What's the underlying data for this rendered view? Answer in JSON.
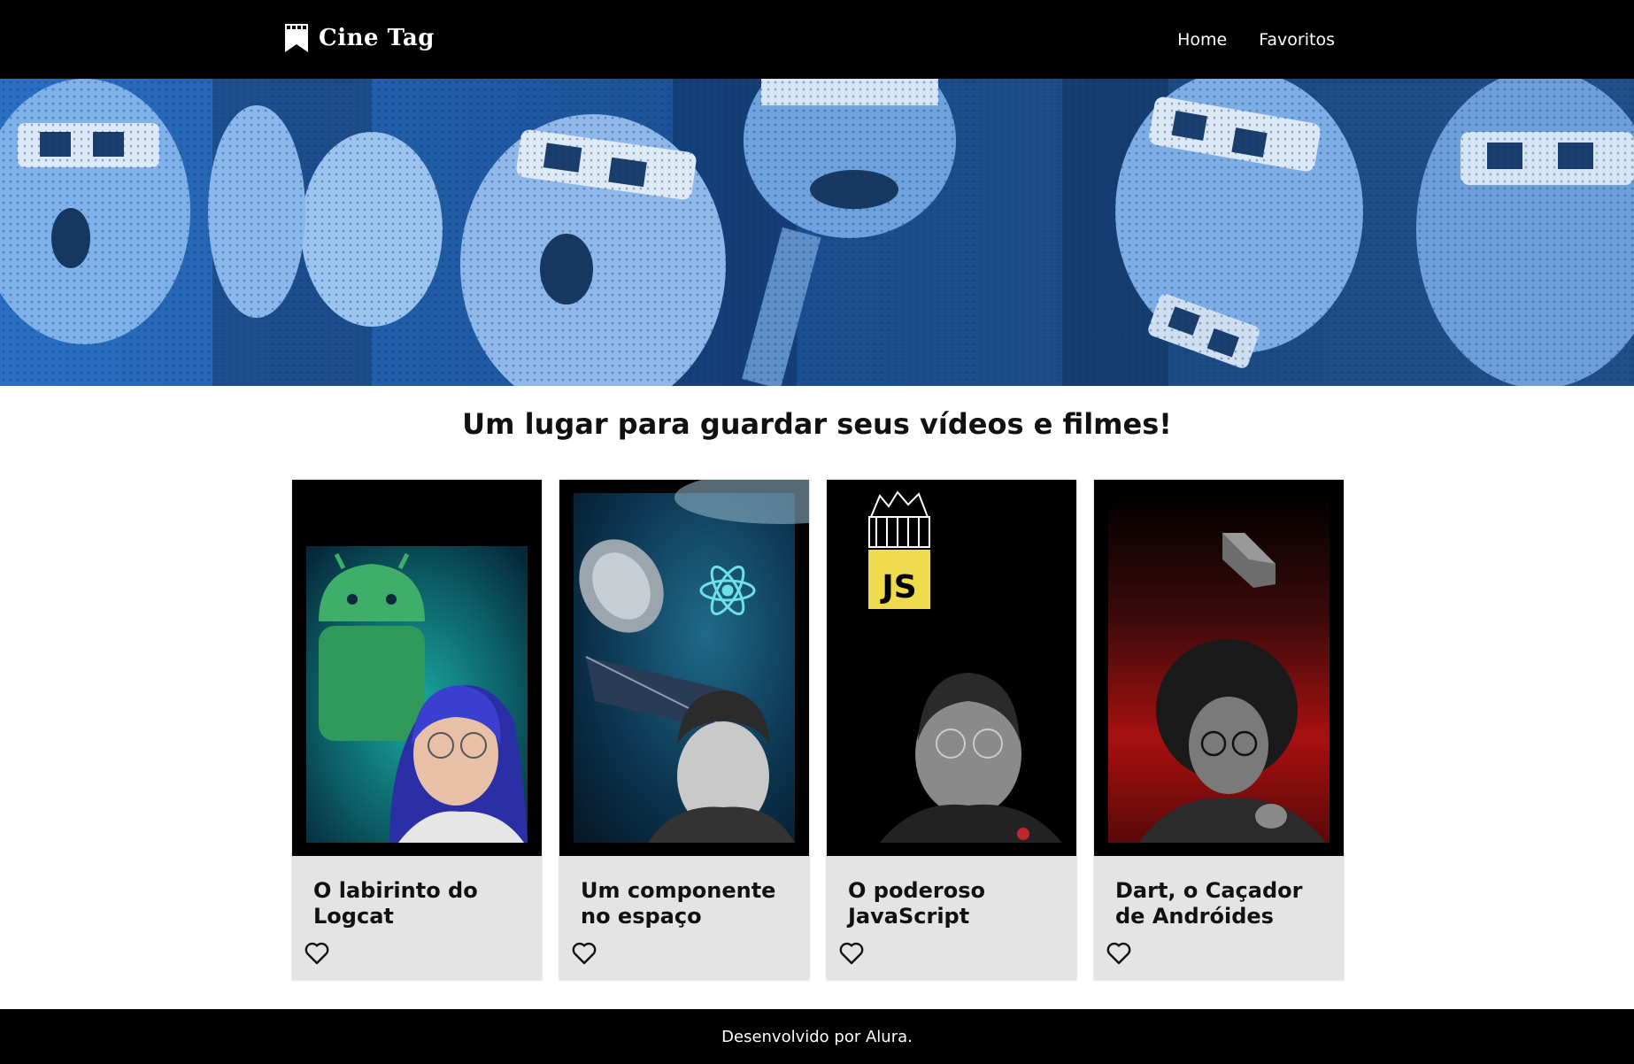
{
  "header": {
    "brand": "Cine Tag",
    "nav": [
      {
        "label": "Home"
      },
      {
        "label": "Favoritos"
      }
    ]
  },
  "main": {
    "title": "Um lugar para guardar seus vídeos e filmes!",
    "videos": [
      {
        "title": "O labirinto do Logcat",
        "favorite": false
      },
      {
        "title": "Um componente no espaço",
        "favorite": false
      },
      {
        "title": "O poderoso JavaScript",
        "favorite": false
      },
      {
        "title": "Dart, o Caçador de Andróides",
        "favorite": false
      }
    ]
  },
  "thumbnails": {
    "js_badge": "JS"
  },
  "footer": {
    "text": "Desenvolvido por Alura."
  },
  "colors": {
    "header_bg": "#000000",
    "banner_tint": "#1f5fa8",
    "card_bg": "#e4e4e4",
    "js_yellow": "#f0db4f"
  }
}
